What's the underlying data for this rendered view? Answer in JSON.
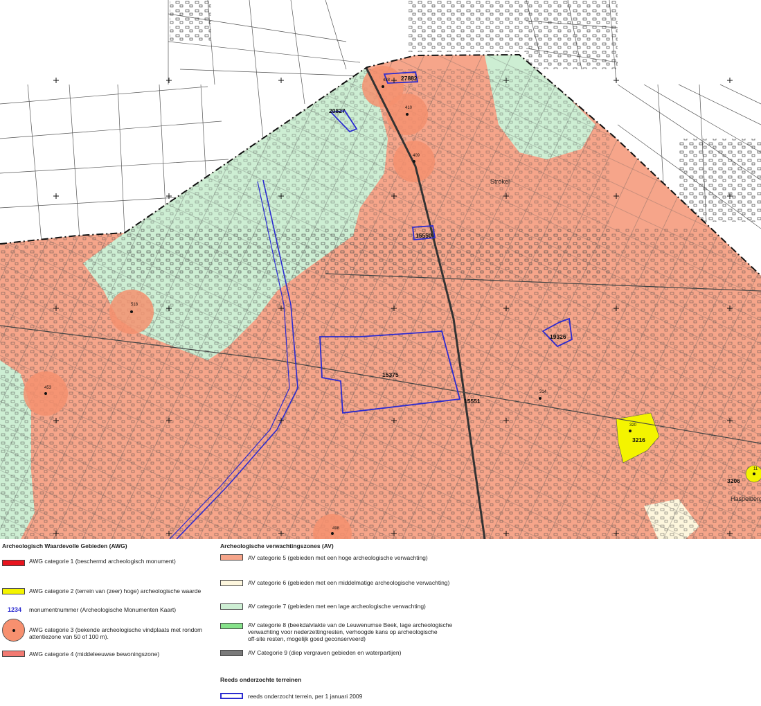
{
  "colors": {
    "av5": "#f6a58a",
    "av6": "#fdf6dd",
    "av7": "#cdeed3",
    "av8": "#86e28a",
    "av9": "#7a7a7a",
    "awg1": "#e8141e",
    "awg2": "#f4f400",
    "awg3": "#f7906f",
    "awg4": "#f27a72",
    "onderzocht": "#2b2bd0"
  },
  "map": {
    "place_labels": [
      "Strokel",
      "Haspelberg"
    ],
    "monument_numbers": [
      "27882",
      "20827",
      "15550",
      "19326",
      "15375",
      "15551",
      "3216",
      "3206"
    ],
    "find_numbers": [
      "488",
      "410",
      "409",
      "518",
      "453",
      "314",
      "320",
      "498",
      "11"
    ]
  },
  "legend": {
    "awg_heading": "Archeologisch Waardevolle Gebieden (AWG)",
    "awg1": "AWG categorie 1 (beschermd archeologisch monument)",
    "awg2": "AWG categorie 2 (terrein van (zeer) hoge) archeologische waarde",
    "mon_swatch": "1234",
    "mon_text": "monumentnummer (Archeologische Monumenten Kaart)",
    "awg3_line1": "AWG categorie 3 (bekende archeologische vindplaats met rondom",
    "awg3_line2": "attentiezone van 50 of 100 m).",
    "awg4": "AWG categorie 4 (middeleeuwse bewoningszone)",
    "av_heading": "Archeologische verwachtingszones (AV)",
    "av5": "AV categorie 5 (gebieden met een hoge archeologische verwachting)",
    "av6": "AV categorie 6 (gebieden met een middelmatige archeologische verwachting)",
    "av7": "AV categorie 7 (gebieden met een lage archeologische verwachting)",
    "av8_line1": "AV categorie 8 (beekdalvlakte van de Leuwenumse Beek, lage archeologische",
    "av8_line2": "verwachting voor nederzettingresten, verhoogde kans op archeologische",
    "av8_line3": "off-site resten, mogelijk goed geconserveerd)",
    "av9": "AV Categorie 9 (diep vergraven gebieden en waterpartijen)",
    "ro_heading": "Reeds onderzochte terreinen",
    "ro_text": "reeds onderzocht terrein, per 1 januari 2009"
  }
}
